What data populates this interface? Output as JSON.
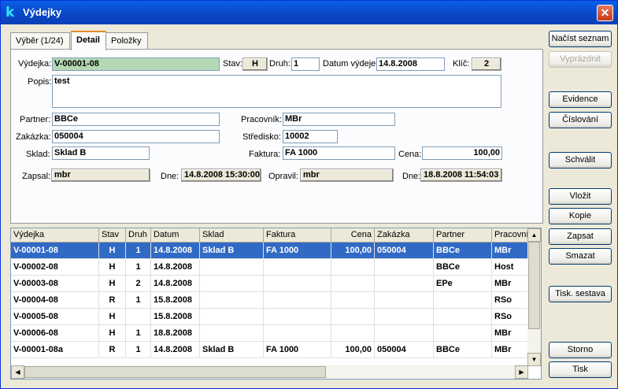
{
  "window": {
    "title": "Výdejky",
    "app_icon": "k",
    "close_glyph": "✕"
  },
  "tabs": [
    {
      "label": "Výběr (1/24)"
    },
    {
      "label": "Detail"
    },
    {
      "label": "Položky"
    }
  ],
  "form": {
    "vydejka_label": "Výdejka:",
    "vydejka_value": "V-00001-08",
    "stav_label": "Stav:",
    "stav_value": "H",
    "druh_label": "Druh:",
    "druh_value": "1",
    "datum_label": "Datum výdeje:",
    "datum_value": "14.8.2008",
    "klic_label": "Klíč:",
    "klic_value": "2",
    "popis_label": "Popis:",
    "popis_value": "test",
    "partner_label": "Partner:",
    "partner_value": "BBCe",
    "pracovnik_label": "Pracovník:",
    "pracovnik_value": "MBr",
    "zakazka_label": "Zakázka:",
    "zakazka_value": "050004",
    "stredisko_label": "Středisko:",
    "stredisko_value": "10002",
    "sklad_label": "Sklad:",
    "sklad_value": "Sklad B",
    "faktura_label": "Faktura:",
    "faktura_value": "FA 1000",
    "cena_label": "Cena:",
    "cena_value": "100,00",
    "zapsal_label": "Zapsal:",
    "zapsal_value": "mbr",
    "dne1_label": "Dne:",
    "dne1_value": "14.8.2008 15:30:00",
    "opravil_label": "Opravil:",
    "opravil_value": "mbr",
    "dne2_label": "Dne:",
    "dne2_value": "18.8.2008 11:54:03"
  },
  "grid": {
    "columns": [
      "Výdejka",
      "Stav",
      "Druh",
      "Datum",
      "Sklad",
      "Faktura",
      "Cena",
      "Zakázka",
      "Partner",
      "Pracovní"
    ],
    "rows": [
      [
        "V-00001-08",
        "H",
        "1",
        "14.8.2008",
        "Sklad B",
        "FA 1000",
        "100,00",
        "050004",
        "BBCe",
        "MBr"
      ],
      [
        "V-00002-08",
        "H",
        "1",
        "14.8.2008",
        "",
        "",
        "",
        "",
        "BBCe",
        "Host"
      ],
      [
        "V-00003-08",
        "H",
        "2",
        "14.8.2008",
        "",
        "",
        "",
        "",
        "EPe",
        "MBr"
      ],
      [
        "V-00004-08",
        "R",
        "1",
        "15.8.2008",
        "",
        "",
        "",
        "",
        "",
        "RSo"
      ],
      [
        "V-00005-08",
        "H",
        "",
        "15.8.2008",
        "",
        "",
        "",
        "",
        "",
        "RSo"
      ],
      [
        "V-00006-08",
        "H",
        "1",
        "18.8.2008",
        "",
        "",
        "",
        "",
        "",
        "MBr"
      ],
      [
        "V-00001-08a",
        "R",
        "1",
        "14.8.2008",
        "Sklad B",
        "FA 1000",
        "100,00",
        "050004",
        "BBCe",
        "MBr"
      ]
    ],
    "selected_row": 0
  },
  "buttons": {
    "nacist": "Načíst seznam",
    "vyprazdnit": "Vyprázdnit",
    "evidence": "Evidence",
    "cislovani": "Číslování",
    "schvalit": "Schválit",
    "vlozit": "Vložit",
    "kopie": "Kopie",
    "zapsat": "Zapsat",
    "smazat": "Smazat",
    "tisk_sestava": "Tisk. sestava",
    "storno": "Storno",
    "tisk": "Tisk"
  }
}
